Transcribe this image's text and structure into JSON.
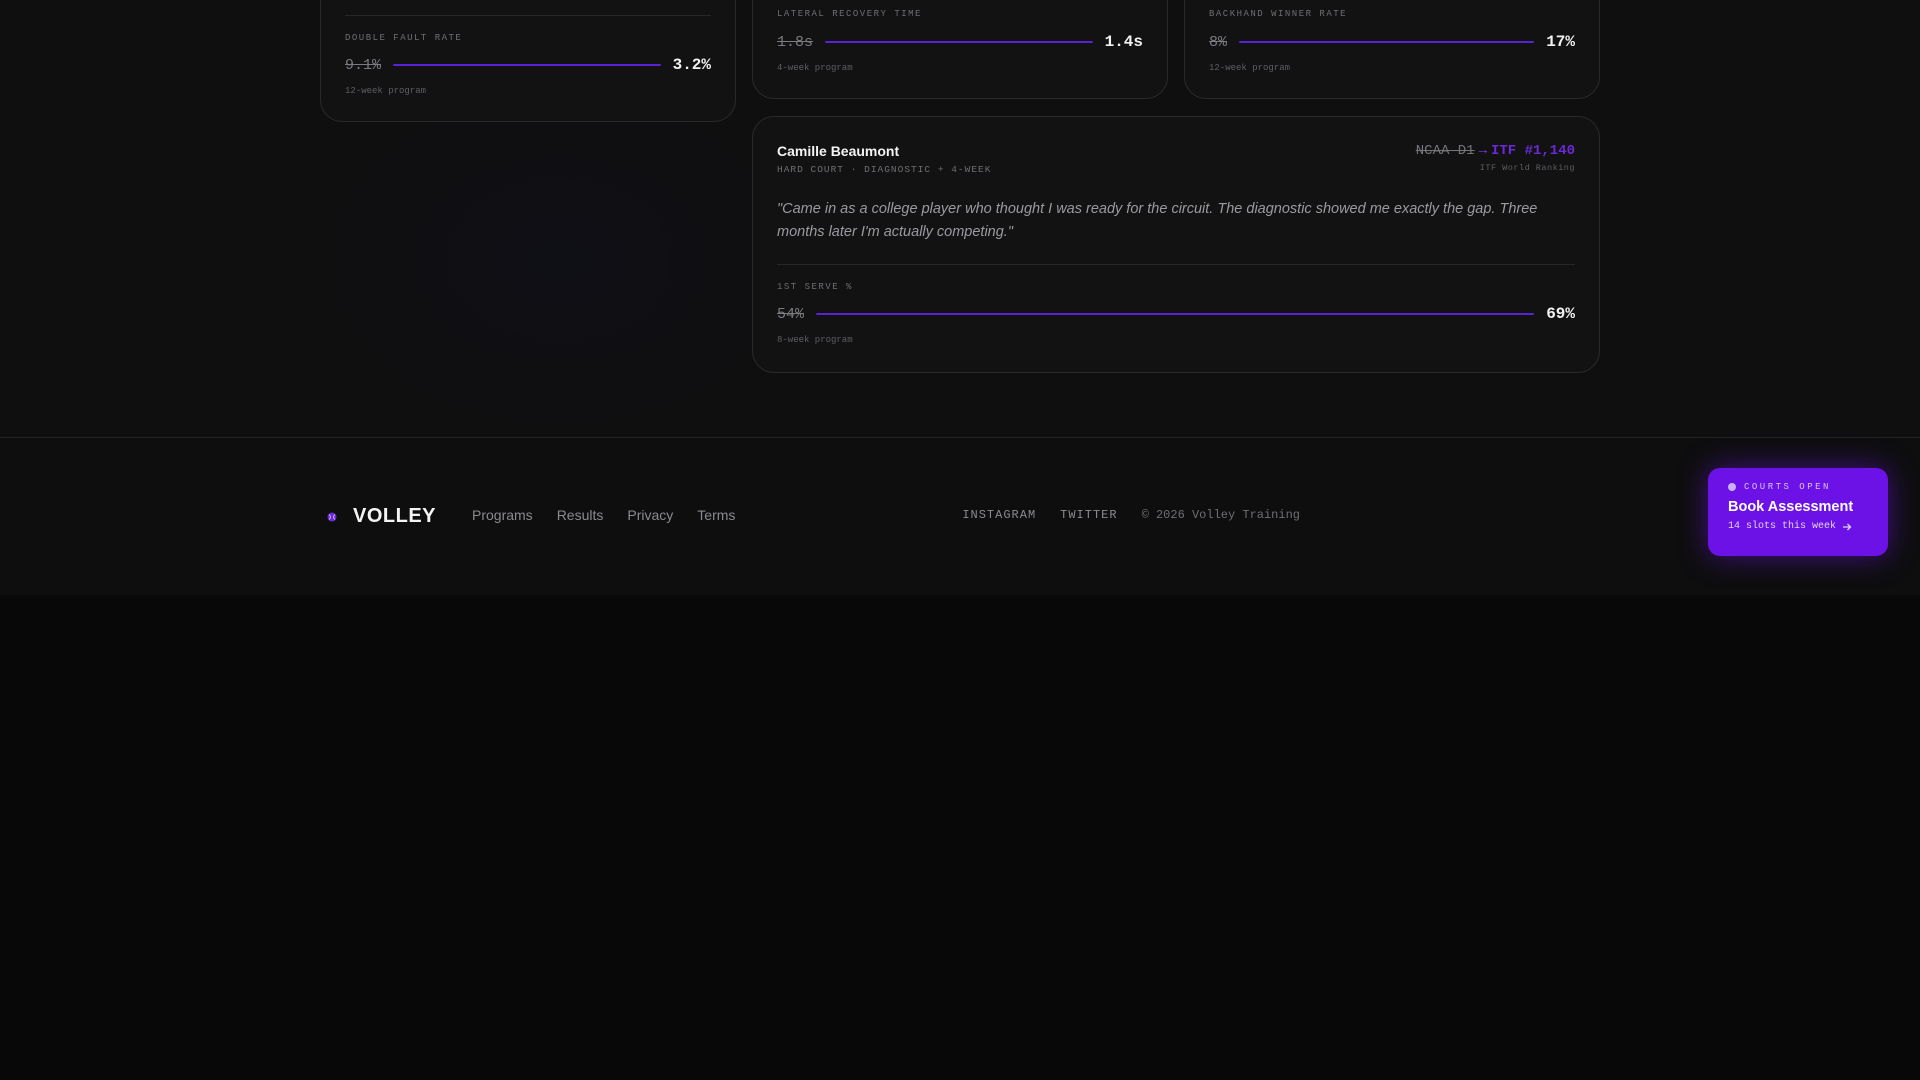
{
  "cards": {
    "left": {
      "metric_label": "DOUBLE FAULT RATE",
      "before": "9.1%",
      "after": "3.2%",
      "note": "12-week program"
    },
    "middle": {
      "metric_label": "LATERAL RECOVERY TIME",
      "before": "1.8s",
      "after": "1.4s",
      "note": "4-week program"
    },
    "right": {
      "metric_label": "BACKHAND WINNER RATE",
      "before": "8%",
      "after": "17%",
      "note": "12-week program"
    },
    "camille": {
      "name": "Camille Beaumont",
      "meta": "HARD COURT · DIAGNOSTIC + 4-WEEK",
      "rank_from": "NCAA D1",
      "rank_to": "ITF #1,140",
      "rank_caption": "ITF World Ranking",
      "quote": "\"Came in as a college player who thought I was ready for the circuit. The diagnostic showed me exactly the gap. Three months later I'm actually competing.\"",
      "metric_label": "1ST SERVE %",
      "before": "54%",
      "after": "69%",
      "note": "8-week program"
    }
  },
  "footer": {
    "logo_text": "VOLLEY",
    "links": [
      "Programs",
      "Results",
      "Privacy",
      "Terms"
    ],
    "social": [
      "INSTAGRAM",
      "TWITTER"
    ],
    "copyright": "© 2026 Volley Training"
  },
  "cta": {
    "status": "COURTS OPEN",
    "title": "Book Assessment",
    "subtitle": "14 slots this week"
  },
  "colors": {
    "accent": "#6d12e6",
    "bar": "#5b21d6",
    "background": "#0f0f10"
  },
  "icons": {
    "logo": "tennis-ball-icon",
    "arrow": "arrow-right-icon"
  }
}
